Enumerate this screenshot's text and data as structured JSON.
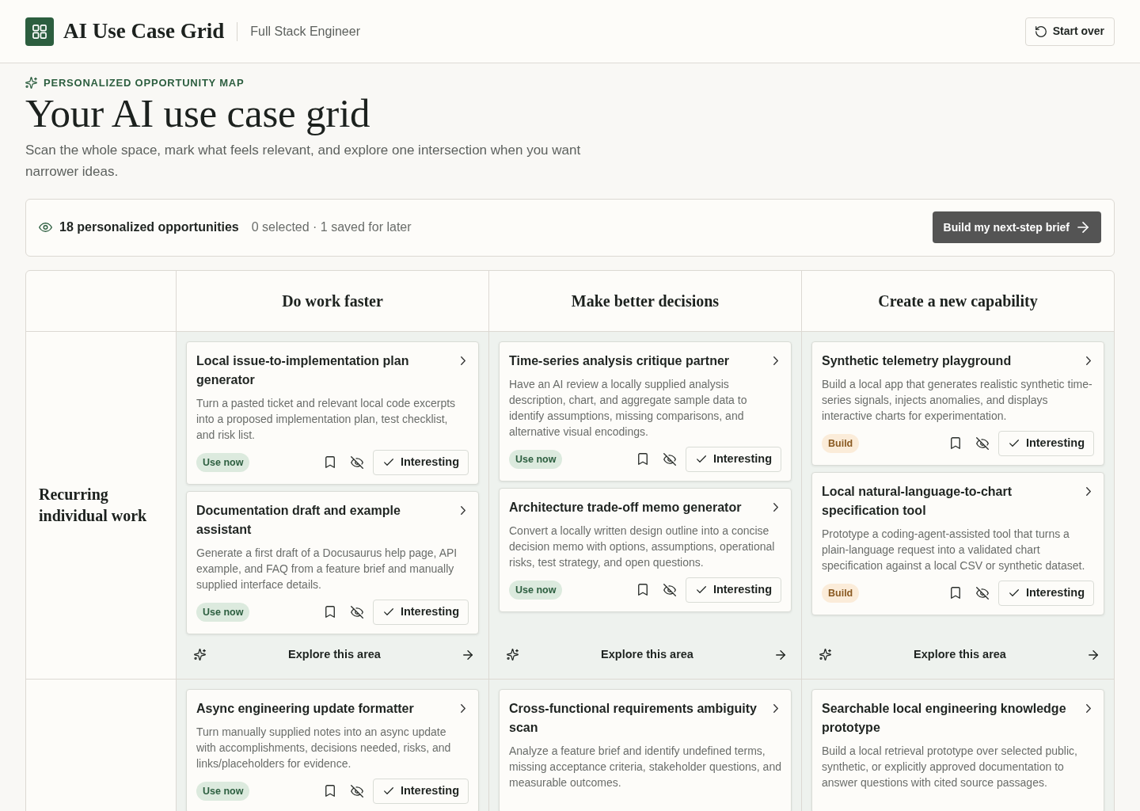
{
  "header": {
    "title": "AI Use Case Grid",
    "role": "Full Stack Engineer",
    "start_over": "Start over"
  },
  "intro": {
    "eyebrow": "PERSONALIZED OPPORTUNITY MAP",
    "title": "Your AI use case grid",
    "description": "Scan the whole space, mark what feels relevant, and explore one intersection when you want narrower ideas."
  },
  "summary": {
    "count": "18 personalized opportunities",
    "status": "0 selected · 1 saved for later",
    "action": "Build my next-step brief"
  },
  "grid": {
    "columns": [
      "Do work faster",
      "Make better decisions",
      "Create a new capability"
    ],
    "rows": [
      {
        "label": "Recurring individual work",
        "cells": [
          {
            "cards": [
              {
                "title": "Local issue-to-implementation plan generator",
                "description": "Turn a pasted ticket and relevant local code excerpts into a proposed implementation plan, test checklist, and risk list.",
                "badge": {
                  "label": "Use now",
                  "kind": "now"
                },
                "saved": false,
                "interesting": {
                  "label": "Interesting",
                  "selected": false
                }
              },
              {
                "title": "Documentation draft and example assistant",
                "description": "Generate a first draft of a Docusaurus help page, API example, and FAQ from a feature brief and manually supplied interface details.",
                "badge": {
                  "label": "Use now",
                  "kind": "now"
                },
                "saved": false,
                "interesting": {
                  "label": "Interesting",
                  "selected": false
                }
              }
            ],
            "explore": "Explore this area"
          },
          {
            "cards": [
              {
                "title": "Time-series analysis critique partner",
                "description": "Have an AI review a locally supplied analysis description, chart, and aggregate sample data to identify assumptions, missing comparisons, and alternative visual encodings.",
                "badge": {
                  "label": "Use now",
                  "kind": "now"
                },
                "saved": false,
                "interesting": {
                  "label": "Interesting",
                  "selected": false
                }
              },
              {
                "title": "Architecture trade-off memo generator",
                "description": "Convert a locally written design outline into a concise decision memo with options, assumptions, operational risks, test strategy, and open questions.",
                "badge": {
                  "label": "Use now",
                  "kind": "now"
                },
                "saved": false,
                "interesting": {
                  "label": "Interesting",
                  "selected": false
                }
              }
            ],
            "explore": "Explore this area"
          },
          {
            "cards": [
              {
                "title": "Synthetic telemetry playground",
                "description": "Build a local app that generates realistic synthetic time-series signals, injects anomalies, and displays interactive charts for experimentation.",
                "badge": {
                  "label": "Build",
                  "kind": "build"
                },
                "saved": false,
                "interesting": {
                  "label": "Interesting",
                  "selected": false
                }
              },
              {
                "title": "Local natural-language-to-chart specification tool",
                "description": "Prototype a coding-agent-assisted tool that turns a plain-language request into a validated chart specification against a local CSV or synthetic dataset.",
                "badge": {
                  "label": "Build",
                  "kind": "build"
                },
                "saved": false,
                "interesting": {
                  "label": "Interesting",
                  "selected": false
                }
              }
            ],
            "explore": "Explore this area"
          }
        ]
      },
      {
        "cells": [
          {
            "cards": [
              {
                "title": "Async engineering update formatter",
                "description": "Turn manually supplied notes into an async update with accomplishments, decisions needed, risks, and links/placeholders for evidence.",
                "badge": {
                  "label": "Use now",
                  "kind": "now"
                },
                "saved": false,
                "interesting": {
                  "label": "Interesting",
                  "selected": false
                }
              }
            ]
          },
          {
            "cards": [
              {
                "title": "Cross-functional requirements ambiguity scan",
                "description": "Analyze a feature brief and identify undefined terms, missing acceptance criteria, stakeholder questions, and measurable outcomes."
              }
            ]
          },
          {
            "cards": [
              {
                "title": "Searchable local engineering knowledge prototype",
                "description": "Build a local retrieval prototype over selected public, synthetic, or explicitly approved documentation to answer questions with cited source passages."
              }
            ]
          }
        ]
      }
    ]
  }
}
